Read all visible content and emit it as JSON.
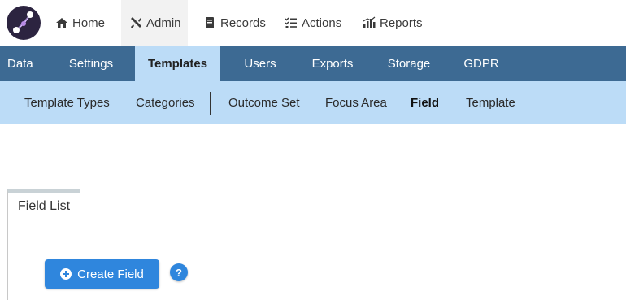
{
  "topnav": {
    "logo_icon": "network-node-logo",
    "items": [
      {
        "label": "Home",
        "icon": "home-icon"
      },
      {
        "label": "Admin",
        "icon": "tools-icon"
      },
      {
        "label": "Records",
        "icon": "book-icon"
      },
      {
        "label": "Actions",
        "icon": "checklist-icon"
      },
      {
        "label": "Reports",
        "icon": "bar-chart-icon"
      }
    ],
    "active": "Admin"
  },
  "admin_tabs": {
    "items": [
      {
        "label": "Data"
      },
      {
        "label": "Settings"
      },
      {
        "label": "Templates"
      },
      {
        "label": "Users"
      },
      {
        "label": "Exports"
      },
      {
        "label": "Storage"
      },
      {
        "label": "GDPR"
      }
    ],
    "active": "Templates"
  },
  "sub_tabs": {
    "items": [
      {
        "label": "Template Types"
      },
      {
        "label": "Categories"
      },
      {
        "label": "Outcome Set"
      },
      {
        "label": "Focus Area"
      },
      {
        "label": "Field"
      },
      {
        "label": "Template"
      }
    ],
    "active": "Field"
  },
  "panel": {
    "tab_label": "Field List",
    "create_button_label": "Create Field",
    "help_label": "?"
  },
  "colors": {
    "admin_bar": "#3d6a93",
    "sub_bar": "#bcdcf7",
    "primary_button": "#2f86dd"
  }
}
